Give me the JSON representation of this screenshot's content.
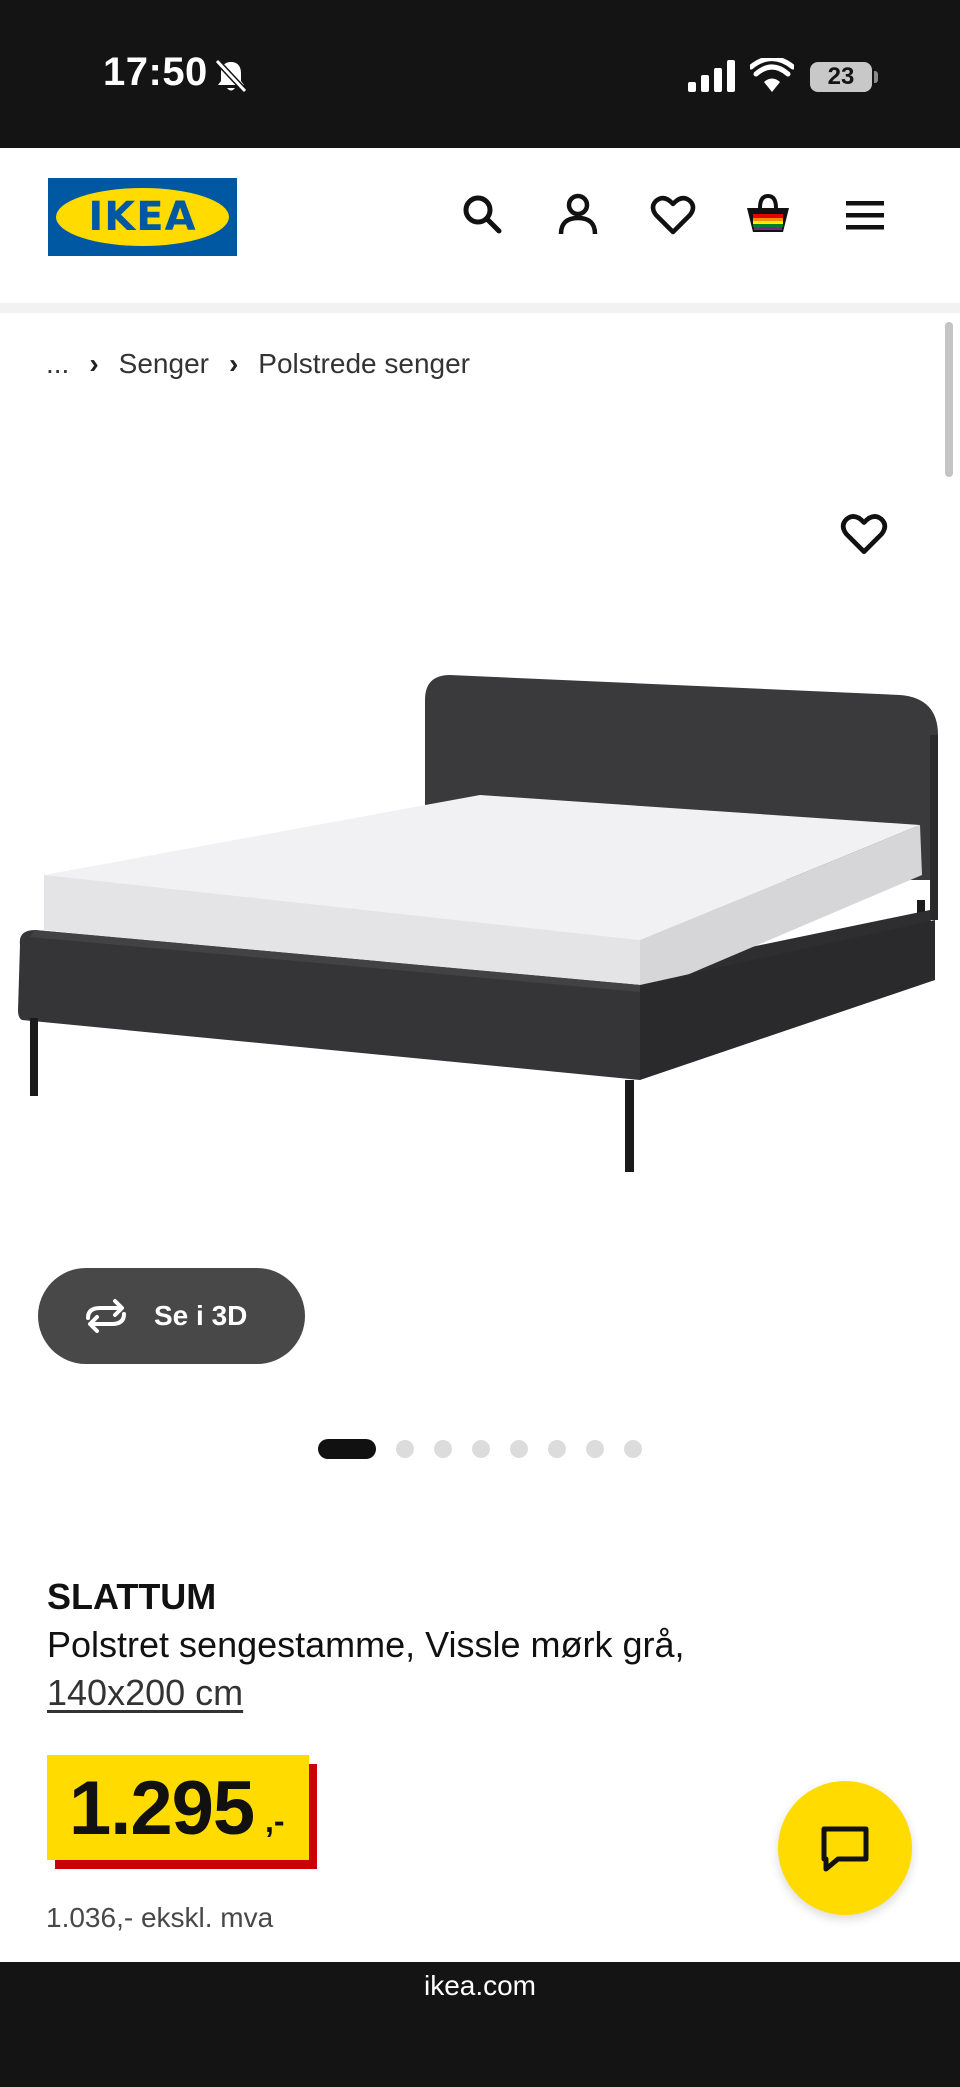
{
  "status_bar": {
    "time": "17:50",
    "battery": "23"
  },
  "header": {
    "logo_text": "IKEA",
    "icons": [
      "search-icon",
      "profile-icon",
      "heart-icon",
      "shopping-bag-icon",
      "menu-icon"
    ]
  },
  "breadcrumb": {
    "ellipsis": "...",
    "items": [
      "Senger",
      "Polstrede senger"
    ]
  },
  "media": {
    "view_3d_label": "Se i 3D",
    "carousel_count": 8,
    "carousel_active": 0
  },
  "product": {
    "name": "SLATTUM",
    "description": "Polstret sengestamme, Vissle mørk grå,",
    "size": "140x200 cm",
    "price": "1.295",
    "price_suffix": ",-",
    "price_ex_vat": "1.036,- ekskl. mva"
  },
  "browser": {
    "url": "ikea.com"
  },
  "colors": {
    "ikea_blue": "#0058a3",
    "ikea_yellow": "#ffdb00",
    "price_red": "#cc0008"
  }
}
